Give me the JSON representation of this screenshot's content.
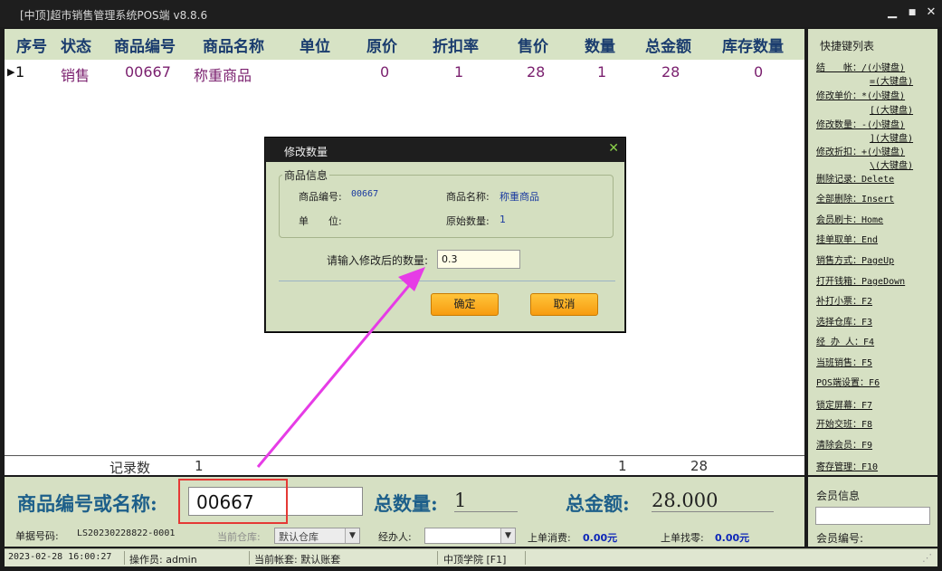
{
  "window": {
    "title": "[中顶]超市销售管理系统POS端 v8.8.6",
    "minimize": "▁",
    "maximize": "■",
    "close": "✕"
  },
  "table": {
    "headers": [
      "序号",
      "状态",
      "商品编号",
      "商品名称",
      "单位",
      "原价",
      "折扣率",
      "售价",
      "数量",
      "总金额",
      "库存数量"
    ],
    "rows": [
      {
        "seq": "1",
        "status": "销售",
        "code": "00667",
        "name": "称重商品",
        "unit": "",
        "orig": "0",
        "discount": "1",
        "price": "28",
        "qty": "1",
        "total": "28",
        "stock": "0"
      }
    ],
    "summary": {
      "label": "记录数",
      "count": "1",
      "qty": "1",
      "total": "28"
    }
  },
  "shortcuts": {
    "title": "快捷键列表",
    "items": [
      "结　　帐：/(小键盘)",
      "=(大键盘)",
      "修改单价：*(小键盘)",
      "[(大键盘)",
      "修改数量：-(小键盘)",
      "](大键盘)",
      "修改折扣：+(小键盘)",
      "\\(大键盘)",
      "删除记录：Delete",
      "全部删除：Insert",
      "会员刷卡：Home",
      "挂单取单：End",
      "销售方式：PageUp",
      "打开钱箱：PageDown",
      "补打小票：F2",
      "选择仓库：F3",
      "经 办 人：F4",
      "当班销售：F5",
      "POS端设置：F6",
      "锁定屏幕：F7",
      "开始交班：F8",
      "清除会员：F9",
      "寄存管理：F10"
    ]
  },
  "bottom": {
    "code_label": "商品编号或名称:",
    "code_value": "00667",
    "total_qty_label": "总数量:",
    "total_qty": "1",
    "total_amount_label": "总金额:",
    "total_amount": "28.000",
    "doc_label": "单据号码:",
    "doc_no": "LS20230228822-0001",
    "warehouse_label": "当前仓库:",
    "warehouse": "默认仓库",
    "agent_label": "经办人:",
    "agent": "",
    "last_spend_label": "上单消费:",
    "last_spend": "0.00元",
    "last_change_label": "上单找零:",
    "last_change": "0.00元"
  },
  "member": {
    "title": "会员信息",
    "no_label": "会员编号:"
  },
  "status": {
    "datetime": "2023-02-28 16:00:27",
    "operator": "操作员: admin",
    "account": "当前帐套: 默认账套",
    "school": "中顶学院 [F1]"
  },
  "dialog": {
    "title": "修改数量",
    "group": "商品信息",
    "code_label": "商品编号:",
    "code": "00667",
    "name_label": "商品名称:",
    "name": "称重商品",
    "unit_label": "单　　位:",
    "unit": "",
    "orig_qty_label": "原始数量:",
    "orig_qty": "1",
    "prompt": "请输入修改后的数量:",
    "qty_value": "0.3",
    "ok": "确定",
    "cancel": "取消",
    "close": "✕"
  },
  "colors": {
    "accent_bg": "#d6e0c3",
    "header_text": "#1a3c6e",
    "row_text": "#7a1f6e",
    "annotation": "#e63ce6",
    "highlight": "#e53935"
  }
}
